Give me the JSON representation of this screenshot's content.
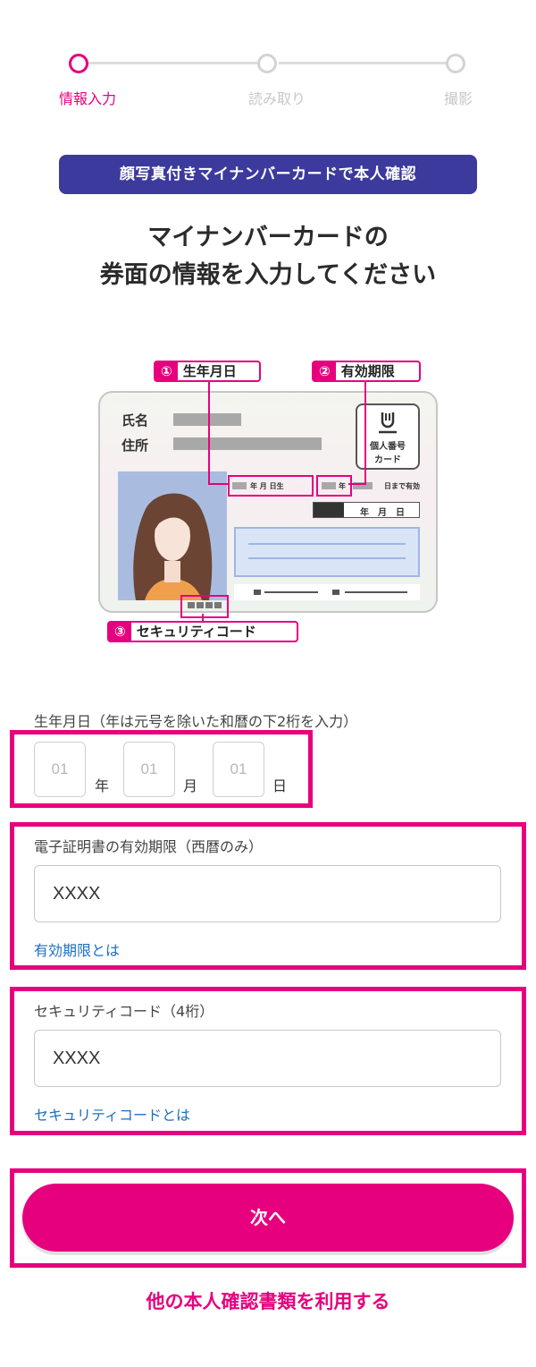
{
  "stepper": {
    "steps": [
      {
        "label": "情報入力",
        "active": true
      },
      {
        "label": "読み取り",
        "active": false
      },
      {
        "label": "撮影",
        "active": false
      }
    ]
  },
  "badge": "顔写真付きマイナンバーカードで本人確認",
  "headline": {
    "line1": "マイナンバーカードの",
    "line2": "券面の情報を入力してください"
  },
  "card_illustration": {
    "name_label": "氏名",
    "address_label": "住所",
    "logo_line1": "個人番号",
    "logo_line2": "カード",
    "birth_fields": "年 月 日生",
    "expiry_fields": "年",
    "expiry_tail": "日まで有効",
    "date_row": "年　月　日",
    "callouts": [
      {
        "num": "①",
        "label": "生年月日"
      },
      {
        "num": "②",
        "label": "有効期限"
      },
      {
        "num": "③",
        "label": "セキュリティコード"
      }
    ]
  },
  "form": {
    "birthdate": {
      "label": "生年月日（年は元号を除いた和暦の下2桁を入力）",
      "year_placeholder": "01",
      "month_placeholder": "01",
      "day_placeholder": "01",
      "year_unit": "年",
      "month_unit": "月",
      "day_unit": "日"
    },
    "expiry": {
      "label": "電子証明書の有効期限（西暦のみ）",
      "value": "XXXX",
      "help_link": "有効期限とは"
    },
    "security_code": {
      "label": "セキュリティコード（4桁）",
      "value": "XXXX",
      "help_link": "セキュリティコードとは"
    }
  },
  "next_button": "次へ",
  "alt_document_link": "他の本人確認書類を利用する",
  "colors": {
    "accent": "#e6007e",
    "badge_bg": "#3c3a9c",
    "link": "#1a6fc2"
  }
}
